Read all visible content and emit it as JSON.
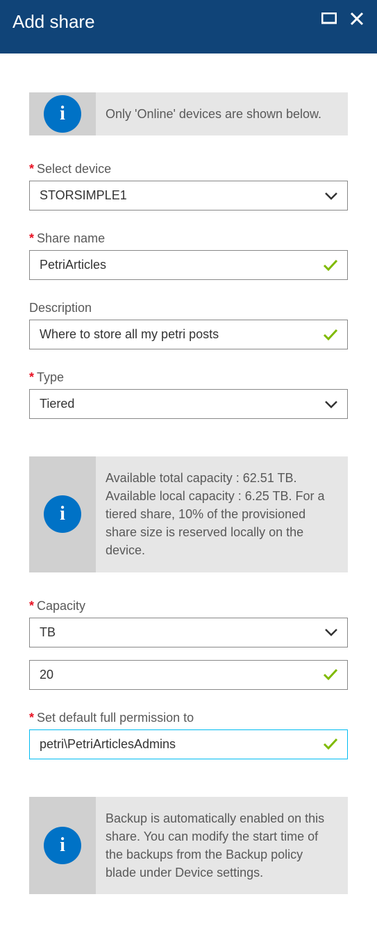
{
  "header": {
    "title": "Add share"
  },
  "info1": "Only 'Online' devices are shown below.",
  "fields": {
    "select_device": {
      "label": "Select device",
      "value": "STORSIMPLE1"
    },
    "share_name": {
      "label": "Share name",
      "value": "PetriArticles"
    },
    "description": {
      "label": "Description",
      "value": "Where to store all my petri posts"
    },
    "type": {
      "label": "Type",
      "value": "Tiered"
    },
    "capacity_label": "Capacity",
    "capacity_unit": {
      "value": "TB"
    },
    "capacity_value": {
      "value": "20"
    },
    "permission": {
      "label": "Set default full permission to",
      "value": "petri\\PetriArticlesAdmins"
    }
  },
  "info2": "Available total capacity : 62.51 TB. Available local capacity : 6.25 TB. For a tiered share, 10% of the provisioned share size is reserved locally on the device.",
  "info3": "Backup is automatically enabled on this share. You can modify the start time of the backups from the Backup policy blade under Device settings."
}
